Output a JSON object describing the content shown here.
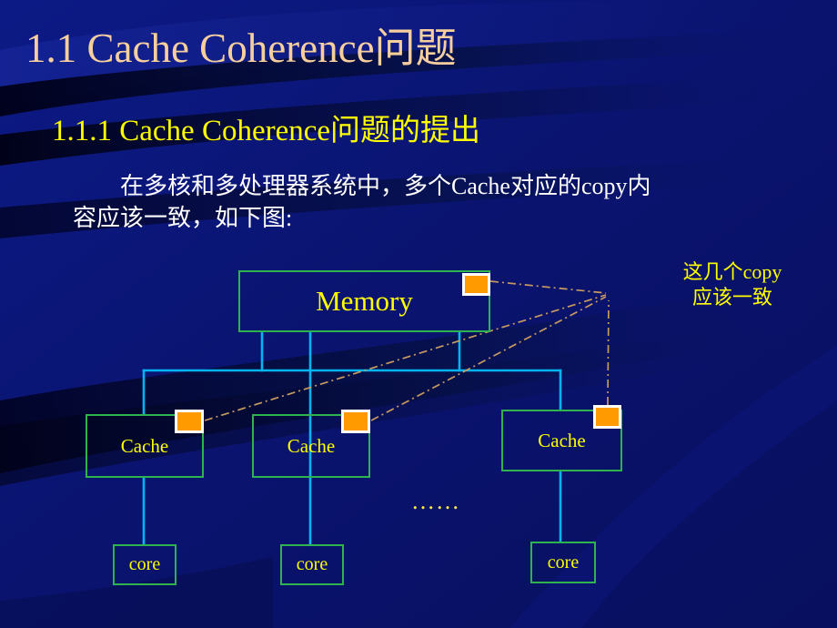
{
  "slide": {
    "title": "1.1 Cache Coherence问题",
    "subtitle": "1.1.1 Cache Coherence问题的提出",
    "body_paragraph": "在多核和多处理器系统中，多个Cache对应的copy内容应该一致，如下图:",
    "ellipsis": "……"
  },
  "annotation": {
    "line1": "这几个copy",
    "line2": "应该一致"
  },
  "diagram": {
    "memory": {
      "label": "Memory"
    },
    "caches": [
      {
        "label": "Cache"
      },
      {
        "label": "Cache"
      },
      {
        "label": "Cache"
      }
    ],
    "cores": [
      {
        "label": "core"
      },
      {
        "label": "core"
      },
      {
        "label": "core"
      }
    ],
    "copy_markers": [
      {
        "owner": "Memory"
      },
      {
        "owner": "Cache 1"
      },
      {
        "owner": "Cache 2"
      },
      {
        "owner": "Cache 3"
      }
    ]
  },
  "colors": {
    "background": "#0b1573",
    "title_text": "#f7cf9e",
    "subtitle_text": "#ffff00",
    "body_text": "#ffffff",
    "node_border": "#2fb34e",
    "node_text": "#ffff00",
    "wire": "#00b5f2",
    "copy_marker": "#ff9b00",
    "copy_marker_border": "#ffffff",
    "callout_line": "#c89a60",
    "annotation_text": "#ffff00"
  }
}
